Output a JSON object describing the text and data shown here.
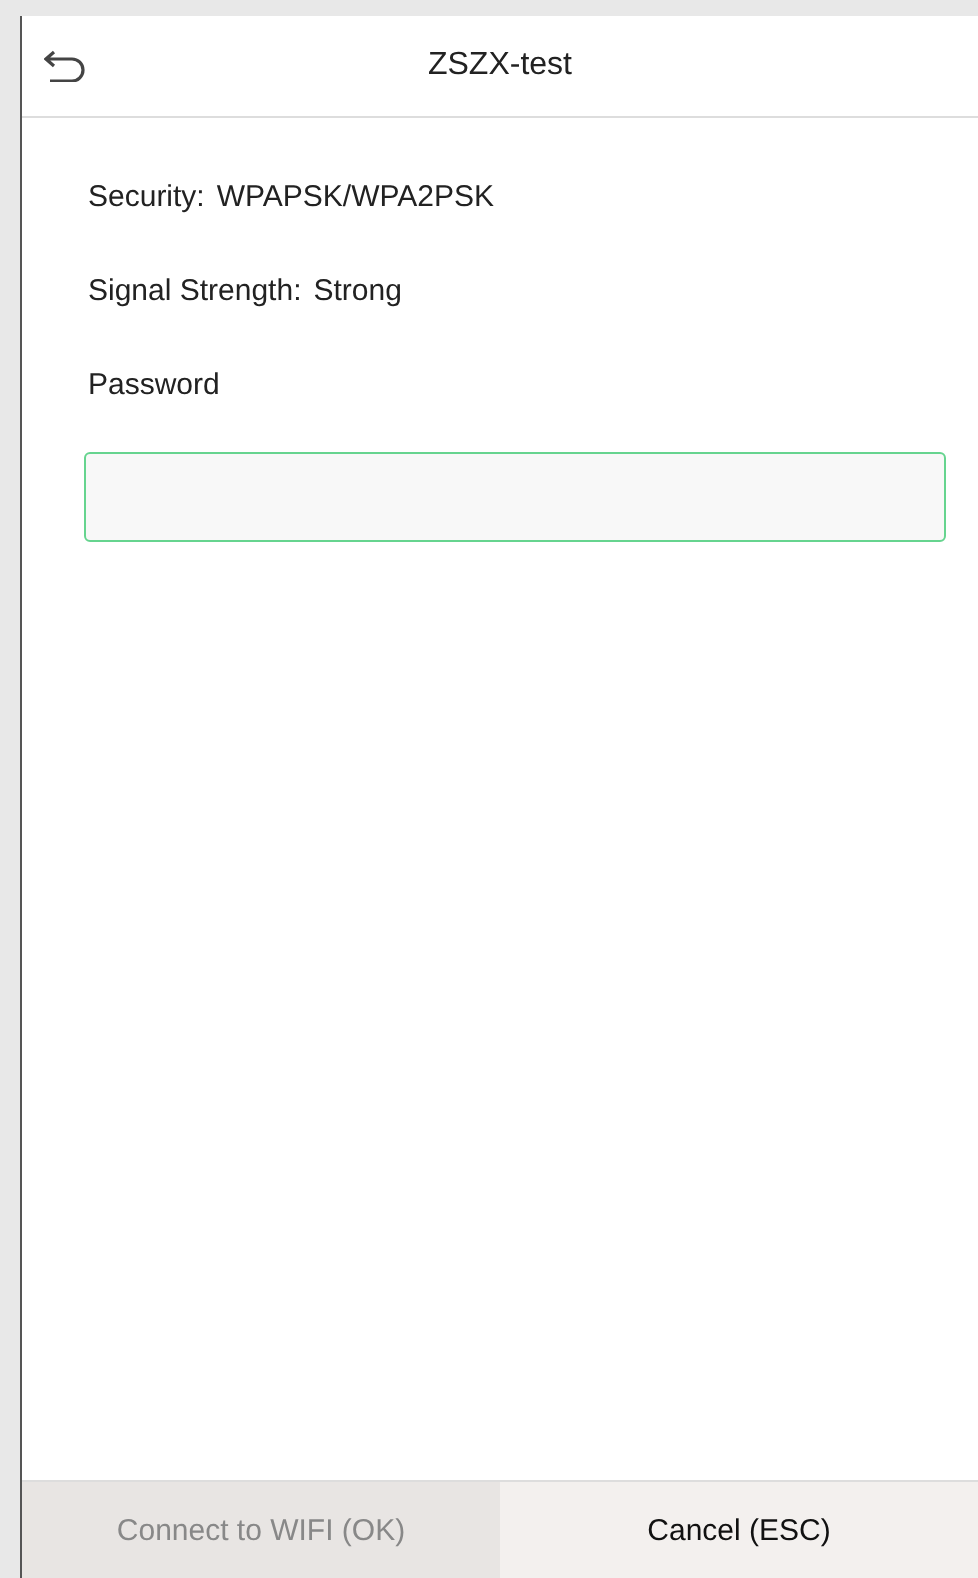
{
  "header": {
    "title": "ZSZX-test"
  },
  "info": [
    {
      "label": "Security:",
      "value": "WPAPSK/WPA2PSK"
    },
    {
      "label": "Signal Strength:",
      "value": "Strong"
    }
  ],
  "password": {
    "label": "Password",
    "focused": true
  },
  "buttons": [
    {
      "label": "Connect to WIFI (OK)",
      "disabled": true
    },
    {
      "label": "Cancel (ESC)",
      "disabled": false
    }
  ]
}
